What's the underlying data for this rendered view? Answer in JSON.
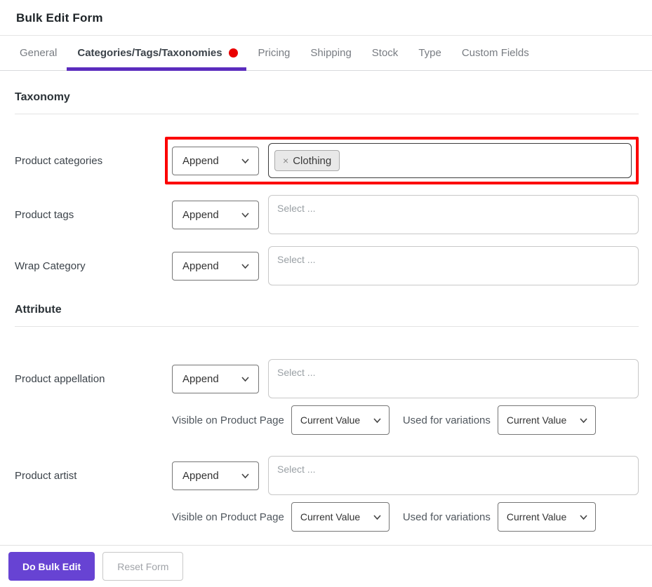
{
  "header": {
    "title": "Bulk Edit Form"
  },
  "tabs": {
    "general": "General",
    "categories": "Categories/Tags/Taxonomies",
    "pricing": "Pricing",
    "shipping": "Shipping",
    "stock": "Stock",
    "type": "Type",
    "custom_fields": "Custom Fields"
  },
  "colors": {
    "accent_purple": "#6743d3",
    "underline_purple": "#5b2cbe",
    "highlight_red": "#fc0000",
    "unsaved_dot_red": "#e90000"
  },
  "icons": {
    "chevron_down": "chevron-down-icon",
    "remove_x": "×"
  },
  "taxonomy": {
    "heading": "Taxonomy",
    "product_categories": {
      "label": "Product categories",
      "mode_value": "Append",
      "chip": {
        "remove": "×",
        "text": "Clothing"
      }
    },
    "product_tags": {
      "label": "Product tags",
      "mode_value": "Append",
      "placeholder": "Select ..."
    },
    "wrap_category": {
      "label": "Wrap Category",
      "mode_value": "Append",
      "placeholder": "Select ..."
    }
  },
  "attribute": {
    "heading": "Attribute",
    "product_appellation": {
      "label": "Product appellation",
      "mode_value": "Append",
      "placeholder": "Select ...",
      "visible_label": "Visible on Product Page",
      "visible_value": "Current Value",
      "variations_label": "Used for variations",
      "variations_value": "Current Value"
    },
    "product_artist": {
      "label": "Product artist",
      "mode_value": "Append",
      "placeholder": "Select ...",
      "visible_label": "Visible on Product Page",
      "visible_value": "Current Value",
      "variations_label": "Used for variations",
      "variations_value": "Current Value"
    }
  },
  "footer": {
    "do_bulk_edit": "Do Bulk Edit",
    "reset_form": "Reset Form"
  }
}
